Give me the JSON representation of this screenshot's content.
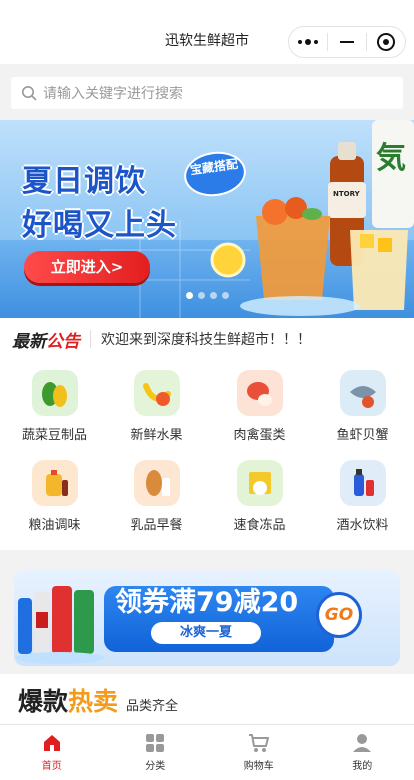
{
  "app": {
    "title": "迅软生鲜超市"
  },
  "search": {
    "placeholder": "请输入关键字进行搜索"
  },
  "banner": {
    "headline_1": "夏日调饮",
    "headline_2": "好喝又上头",
    "badge": "宝藏搭配",
    "button_label": "立即进入>",
    "brand_text": "SUNTORY",
    "slide_count": 4,
    "active_slide": 1
  },
  "notice": {
    "logo_part1": "最新",
    "logo_part2": "公告",
    "text": "欢迎来到深度科技生鲜超市！！！"
  },
  "categories": [
    {
      "label": "蔬菜豆制品",
      "icon": "vegetable-icon",
      "bg": "#dff3d8"
    },
    {
      "label": "新鲜水果",
      "icon": "fruit-icon",
      "bg": "#e4f4d8"
    },
    {
      "label": "肉禽蛋类",
      "icon": "meat-icon",
      "bg": "#fde3d6"
    },
    {
      "label": "鱼虾贝蟹",
      "icon": "seafood-icon",
      "bg": "#dcecf7"
    },
    {
      "label": "粮油调味",
      "icon": "oil-icon",
      "bg": "#fde8cf"
    },
    {
      "label": "乳品早餐",
      "icon": "bread-icon",
      "bg": "#fde6d2"
    },
    {
      "label": "速食冻品",
      "icon": "frozen-food-icon",
      "bg": "#e2f3d6"
    },
    {
      "label": "酒水饮料",
      "icon": "drink-icon",
      "bg": "#e0ecf8"
    }
  ],
  "promo": {
    "title": "领券满79减20",
    "subtitle": "冰爽一夏",
    "go_label": "GO"
  },
  "hot": {
    "title_part1": "爆款",
    "title_part2": "热卖",
    "subtitle": "品类齐全"
  },
  "tabbar": [
    {
      "label": "首页",
      "icon": "home-icon",
      "active": true
    },
    {
      "label": "分类",
      "icon": "category-icon",
      "active": false
    },
    {
      "label": "购物车",
      "icon": "cart-icon",
      "active": false
    },
    {
      "label": "我的",
      "icon": "user-icon",
      "active": false
    }
  ],
  "colors": {
    "accent": "#e02020",
    "hot_orange": "#f39b1a",
    "promo_blue": "#1d63d6"
  }
}
